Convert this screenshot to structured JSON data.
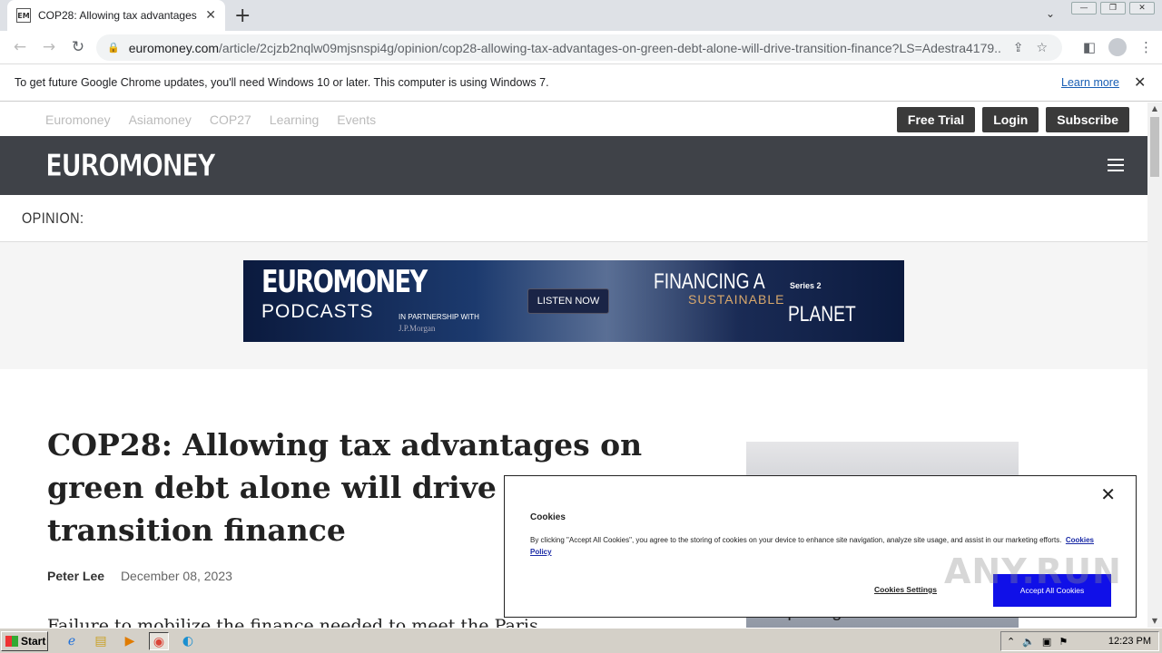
{
  "browser": {
    "tab_favicon": "EM",
    "tab_title": "COP28: Allowing tax advantages on green debt alone will drive transition finance",
    "tab_close": "✕",
    "new_tab": "+",
    "tab_menu": "⌄",
    "url_host": "euromoney.com",
    "url_path": "/article/2cjzb2nqlw09mjsnspi4g/opinion/cop28-allowing-tax-advantages-on-green-debt-alone-will-drive-transition-finance?LS=Adestra4179...",
    "window_buttons": [
      "—",
      "❐",
      "✕"
    ]
  },
  "infobar": {
    "message": "To get future Google Chrome updates, you'll need Windows 10 or later. This computer is using Windows 7.",
    "learn_more": "Learn more",
    "close": "✕"
  },
  "site": {
    "topnav_links": [
      "Euromoney",
      "Asiamoney",
      "COP27",
      "Learning",
      "Events"
    ],
    "free_trial": "Free Trial",
    "login": "Login",
    "subscribe": "Subscribe",
    "logo": "EUROMONEY",
    "section_label": "OPINION:"
  },
  "ad": {
    "brand": "EUROMONEY",
    "podcasts": "PODCASTS",
    "partner": "IN PARTNERSHIP WITH",
    "partner_name": "J.P.Morgan",
    "listen": "LISTEN NOW",
    "fin1": "FINANCING A",
    "fin2": "SUSTAINABLE",
    "fin3": "PLANET",
    "series": "Series 2"
  },
  "article": {
    "headline": "COP28: Allowing tax advantages on green debt alone will drive transition finance",
    "author": "Peter Lee",
    "date": "December 08, 2023",
    "lede": "Failure to mobilize the finance needed to meet the Paris",
    "side_text": "Exploring"
  },
  "cookie": {
    "close": "✕",
    "title": "Cookies",
    "body": "By clicking \"Accept All Cookies\", you agree to the storing of cookies on your device to enhance site navigation, analyze site usage, and assist in our marketing efforts.",
    "policy_link": "Cookies Policy",
    "settings": "Cookies Settings",
    "accept": "Accept All Cookies"
  },
  "watermark": "ANY.RUN",
  "taskbar": {
    "start": "Start",
    "clock": "12:23 PM"
  }
}
